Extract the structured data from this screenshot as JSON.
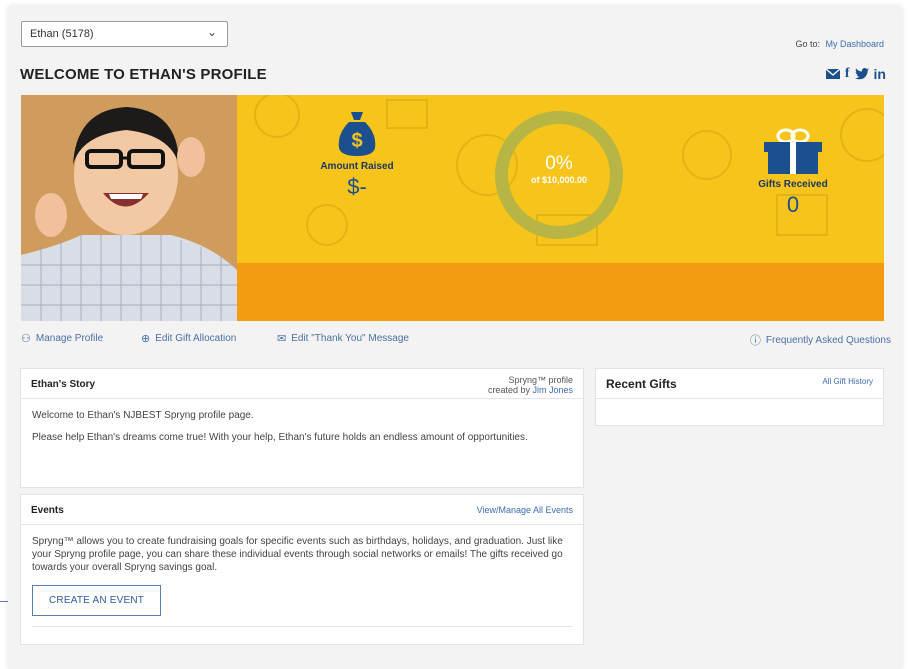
{
  "selector": {
    "value": "Ethan (5178)",
    "icon": "chevron-down-icon"
  },
  "goto": {
    "label": "Go to:",
    "link": "My Dashboard"
  },
  "page_title": "WELCOME TO ETHAN'S PROFILE",
  "social_icons": [
    "mail-icon",
    "facebook-icon",
    "twitter-icon",
    "linkedin-icon"
  ],
  "social_glyphs": {
    "facebook": "f",
    "linkedin": "in"
  },
  "banner": {
    "amount_raised": {
      "label": "Amount Raised",
      "value": "$-",
      "icon": "money-bag-icon"
    },
    "progress": {
      "percent": "0%",
      "goal": "of $10,000.00",
      "fraction": 0
    },
    "gifts_received": {
      "label": "Gifts Received",
      "value": "0",
      "icon": "gift-icon"
    },
    "colors": {
      "yellow": "#f6c41a",
      "orange": "#f39c12",
      "navy": "#1b4f8e"
    }
  },
  "actions": [
    {
      "label": "Manage Profile",
      "icon": "user-icon"
    },
    {
      "label": "Edit Gift Allocation",
      "icon": "globe-gift-icon"
    },
    {
      "label": "Edit \"Thank You\" Message",
      "icon": "envelope-icon"
    },
    {
      "label": "Frequently Asked Questions",
      "icon": "question-circle-icon"
    }
  ],
  "story": {
    "title": "Ethan's Story",
    "profile_note": "Spryng™ profile",
    "created_by_label": "created by",
    "created_by": "Jim Jones",
    "paragraphs": [
      "Welcome to Ethan's NJBEST Spryng profile page.",
      "Please help Ethan's dreams come true!  With your help, Ethan's future holds an endless amount of opportunities."
    ]
  },
  "events": {
    "title": "Events",
    "manage_link": "View/Manage All Events",
    "description": "Spryng™ allows you to create fundraising goals for specific events such as birthdays, holidays, and graduation. Just like your Spryng profile page, you can share these individual events through social networks or emails! The gifts received go towards your overall Spryng savings goal.",
    "button": "CREATE AN EVENT"
  },
  "recent_gifts": {
    "title": "Recent Gifts",
    "history_link": "All Gift History"
  }
}
